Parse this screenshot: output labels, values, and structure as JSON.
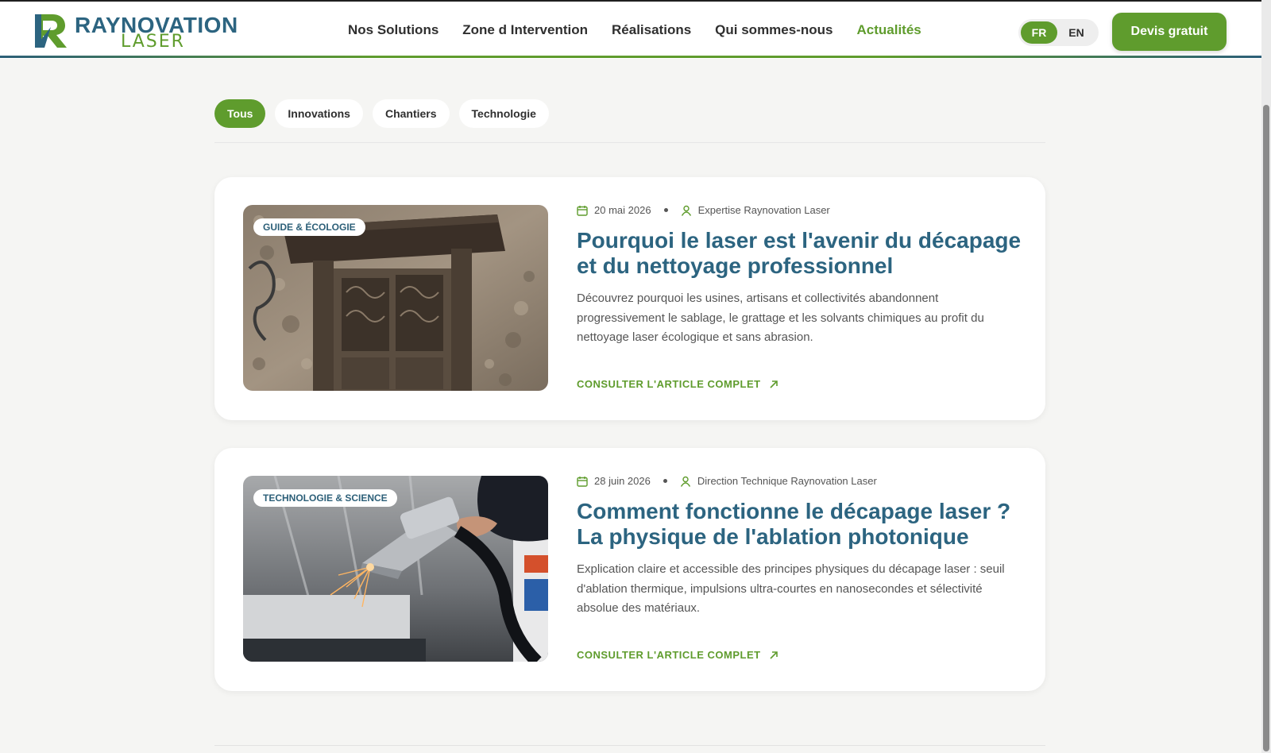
{
  "brand": {
    "name_line1": "RAYNOVATION",
    "name_line2": "LASER",
    "color_primary": "#2c6480",
    "color_accent": "#5f9c2d"
  },
  "nav": {
    "items": [
      {
        "label": "Nos Solutions"
      },
      {
        "label": "Zone d Intervention"
      },
      {
        "label": "Réalisations"
      },
      {
        "label": "Qui sommes-nous"
      },
      {
        "label": "Actualités",
        "active": true
      }
    ]
  },
  "lang": {
    "fr": "FR",
    "en": "EN",
    "selected": "FR"
  },
  "cta": {
    "label": "Devis gratuit"
  },
  "filters": {
    "items": [
      {
        "label": "Tous",
        "active": true
      },
      {
        "label": "Innovations"
      },
      {
        "label": "Chantiers"
      },
      {
        "label": "Technologie"
      }
    ]
  },
  "articles": [
    {
      "badge": "GUIDE & ÉCOLOGIE",
      "date": "20 mai 2026",
      "author": "Expertise Raynovation Laser",
      "title": "Pourquoi le laser est l'avenir du décapage et du nettoyage professionnel",
      "description": "Découvrez pourquoi les usines, artisans et collectivités abandonnent progressivement le sablage, le grattage et les solvants chimiques au profit du nettoyage laser écologique et sans abrasion.",
      "link": "CONSULTER L'ARTICLE COMPLET",
      "image": "old-wooden-door-photo"
    },
    {
      "badge": "TECHNOLOGIE & SCIENCE",
      "date": "28 juin 2026",
      "author": "Direction Technique Raynovation Laser",
      "title": "Comment fonctionne le décapage laser ? La physique de l'ablation photonique",
      "description": "Explication claire et accessible des principes physiques du décapage laser : seuil d'ablation thermique, impulsions ultra-courtes en nanosecondes et sélectivité absolue des matériaux.",
      "link": "CONSULTER L'ARTICLE COMPLET",
      "image": "laser-cleaning-gun-photo"
    }
  ],
  "icons": {
    "date": "calendar-icon",
    "author": "user-icon",
    "link": "arrow-up-right-icon"
  }
}
